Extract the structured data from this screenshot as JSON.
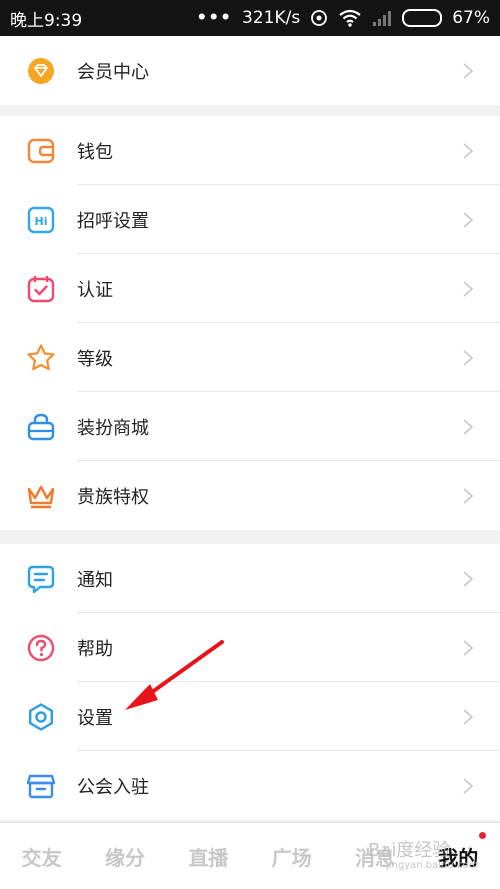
{
  "status_bar": {
    "time": "晚上9:39",
    "dots": "•••",
    "net_speed": "321K/s",
    "battery_percent": "67%",
    "battery_level": 0.67
  },
  "menu": {
    "vip": {
      "label": "会员中心",
      "icon": "diamond-icon"
    },
    "group1": [
      {
        "label": "钱包",
        "icon": "wallet-icon"
      },
      {
        "label": "招呼设置",
        "icon": "hi-icon"
      },
      {
        "label": "认证",
        "icon": "calendar-check-icon"
      },
      {
        "label": "等级",
        "icon": "star-icon"
      },
      {
        "label": "装扮商城",
        "icon": "shopping-bag-icon"
      },
      {
        "label": "贵族特权",
        "icon": "crown-icon"
      }
    ],
    "group2": [
      {
        "label": "通知",
        "icon": "message-icon"
      },
      {
        "label": "帮助",
        "icon": "question-icon"
      },
      {
        "label": "设置",
        "icon": "gear-icon"
      },
      {
        "label": "公会入驻",
        "icon": "store-icon"
      }
    ]
  },
  "bottom_nav": {
    "items": [
      "交友",
      "缘分",
      "直播",
      "广场",
      "消息",
      "我的"
    ],
    "active": "我的"
  },
  "watermark": {
    "text": "Bai度经验",
    "sub": "jingyan.baidu.com"
  },
  "colors": {
    "vip": "#f5a623",
    "wallet": "#f0883a",
    "hi": "#2fa8e6",
    "auth": "#ef4a6d",
    "level": "#f5902c",
    "shop": "#2c8fe8",
    "crown": "#f07a2a",
    "notify": "#2ba1e8",
    "help": "#ea4f6e",
    "settings": "#2b9fe6",
    "guild": "#3c8de8",
    "annotation_arrow": "#e8131b"
  }
}
